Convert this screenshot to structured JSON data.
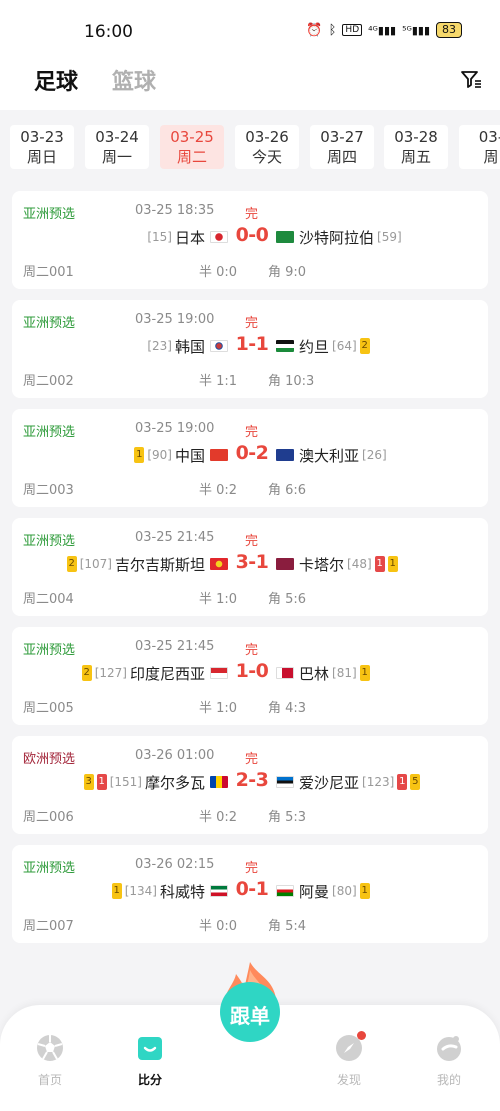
{
  "status_bar": {
    "time": "16:00",
    "battery": "83"
  },
  "header": {
    "tab_football": "足球",
    "tab_basketball": "篮球"
  },
  "dates": [
    {
      "d": "03-23",
      "w": "周日"
    },
    {
      "d": "03-24",
      "w": "周一"
    },
    {
      "d": "03-25",
      "w": "周二"
    },
    {
      "d": "03-26",
      "w": "今天"
    },
    {
      "d": "03-27",
      "w": "周四"
    },
    {
      "d": "03-28",
      "w": "周五"
    },
    {
      "d": "03-",
      "w": "周"
    }
  ],
  "active_date_index": 2,
  "matches": [
    {
      "league": "亚洲预选",
      "time": "03-25 18:35",
      "status": "完",
      "home": "日本",
      "home_rank": "[15]",
      "away": "沙特阿拉伯",
      "away_rank": "[59]",
      "score": "0-0",
      "code": "周二001",
      "half": "半 0:0",
      "corner": "角 9:0",
      "home_cards": [],
      "away_cards": []
    },
    {
      "league": "亚洲预选",
      "time": "03-25 19:00",
      "status": "完",
      "home": "韩国",
      "home_rank": "[23]",
      "away": "约旦",
      "away_rank": "[64]",
      "score": "1-1",
      "code": "周二002",
      "half": "半 1:1",
      "corner": "角 10:3",
      "home_cards": [],
      "away_cards": [
        {
          "type": "y",
          "n": "2"
        }
      ]
    },
    {
      "league": "亚洲预选",
      "time": "03-25 19:00",
      "status": "完",
      "home": "中国",
      "home_rank": "[90]",
      "away": "澳大利亚",
      "away_rank": "[26]",
      "score": "0-2",
      "code": "周二003",
      "half": "半 0:2",
      "corner": "角 6:6",
      "home_cards": [
        {
          "type": "y",
          "n": "1"
        }
      ],
      "away_cards": []
    },
    {
      "league": "亚洲预选",
      "time": "03-25 21:45",
      "status": "完",
      "home": "吉尔吉斯斯坦",
      "home_rank": "[107]",
      "away": "卡塔尔",
      "away_rank": "[48]",
      "score": "3-1",
      "code": "周二004",
      "half": "半 1:0",
      "corner": "角 5:6",
      "home_cards": [
        {
          "type": "y",
          "n": "2"
        }
      ],
      "away_cards": [
        {
          "type": "r",
          "n": "1"
        },
        {
          "type": "y",
          "n": "1"
        }
      ]
    },
    {
      "league": "亚洲预选",
      "time": "03-25 21:45",
      "status": "完",
      "home": "印度尼西亚",
      "home_rank": "[127]",
      "away": "巴林",
      "away_rank": "[81]",
      "score": "1-0",
      "code": "周二005",
      "half": "半 1:0",
      "corner": "角 4:3",
      "home_cards": [
        {
          "type": "y",
          "n": "2"
        }
      ],
      "away_cards": [
        {
          "type": "y",
          "n": "1"
        }
      ]
    },
    {
      "league": "欧洲预选",
      "time": "03-26 01:00",
      "status": "完",
      "home": "摩尔多瓦",
      "home_rank": "[151]",
      "away": "爱沙尼亚",
      "away_rank": "[123]",
      "score": "2-3",
      "code": "周二006",
      "half": "半 0:2",
      "corner": "角 5:3",
      "home_cards": [
        {
          "type": "y",
          "n": "3"
        },
        {
          "type": "r",
          "n": "1"
        }
      ],
      "away_cards": [
        {
          "type": "r",
          "n": "1"
        },
        {
          "type": "y",
          "n": "5"
        }
      ]
    },
    {
      "league": "亚洲预选",
      "time": "03-26 02:15",
      "status": "完",
      "home": "科威特",
      "home_rank": "[134]",
      "away": "阿曼",
      "away_rank": "[80]",
      "score": "0-1",
      "code": "周二007",
      "half": "半 0:0",
      "corner": "角 5:4",
      "home_cards": [
        {
          "type": "y",
          "n": "1"
        }
      ],
      "away_cards": [
        {
          "type": "y",
          "n": "1"
        }
      ]
    }
  ],
  "bottom_nav": {
    "home": "首页",
    "score": "比分",
    "follow": "跟单",
    "discover": "发现",
    "mine": "我的"
  },
  "colors": {
    "accent": "#e8473d",
    "league_asia": "#2e9b3a",
    "league_europe": "#a3263a",
    "follow_button": "#2fd6c4"
  }
}
